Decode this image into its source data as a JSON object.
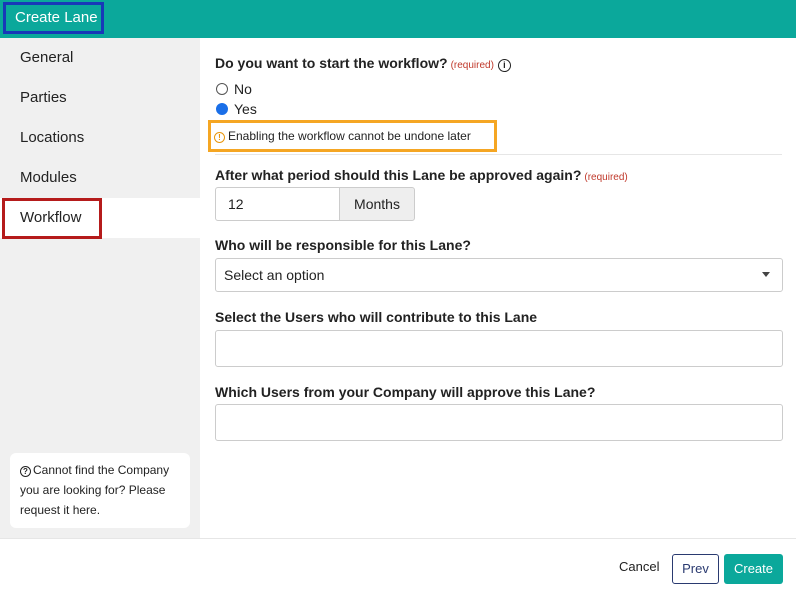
{
  "header": {
    "title": "Create Lane"
  },
  "sidebar": {
    "items": [
      {
        "label": "General"
      },
      {
        "label": "Parties"
      },
      {
        "label": "Locations"
      },
      {
        "label": "Modules"
      },
      {
        "label": "Workflow",
        "active": true
      }
    ],
    "help_text": "Cannot find the Company you are looking for? Please request it here."
  },
  "form": {
    "start_workflow": {
      "question": "Do you want to start the workflow?",
      "required": "(required)",
      "options": [
        "No",
        "Yes"
      ],
      "selected": "Yes",
      "warning": "Enabling the workflow cannot be undone later"
    },
    "approval_period": {
      "question": "After what period should this Lane be approved again?",
      "required": "(required)",
      "value": "12",
      "unit": "Months"
    },
    "responsible": {
      "question": "Who will be responsible for this Lane?",
      "selected": "Select an option"
    },
    "contributors": {
      "question": "Select the Users who will contribute to this Lane",
      "value": ""
    },
    "approvers": {
      "question": "Which Users from your Company will approve this Lane?",
      "value": ""
    }
  },
  "footer": {
    "cancel": "Cancel",
    "prev": "Prev",
    "create": "Create"
  },
  "colors": {
    "brand": "#0ba89b",
    "required": "#c0392b",
    "warning": "#f5a623",
    "radio_checked": "#1a6fe8"
  }
}
